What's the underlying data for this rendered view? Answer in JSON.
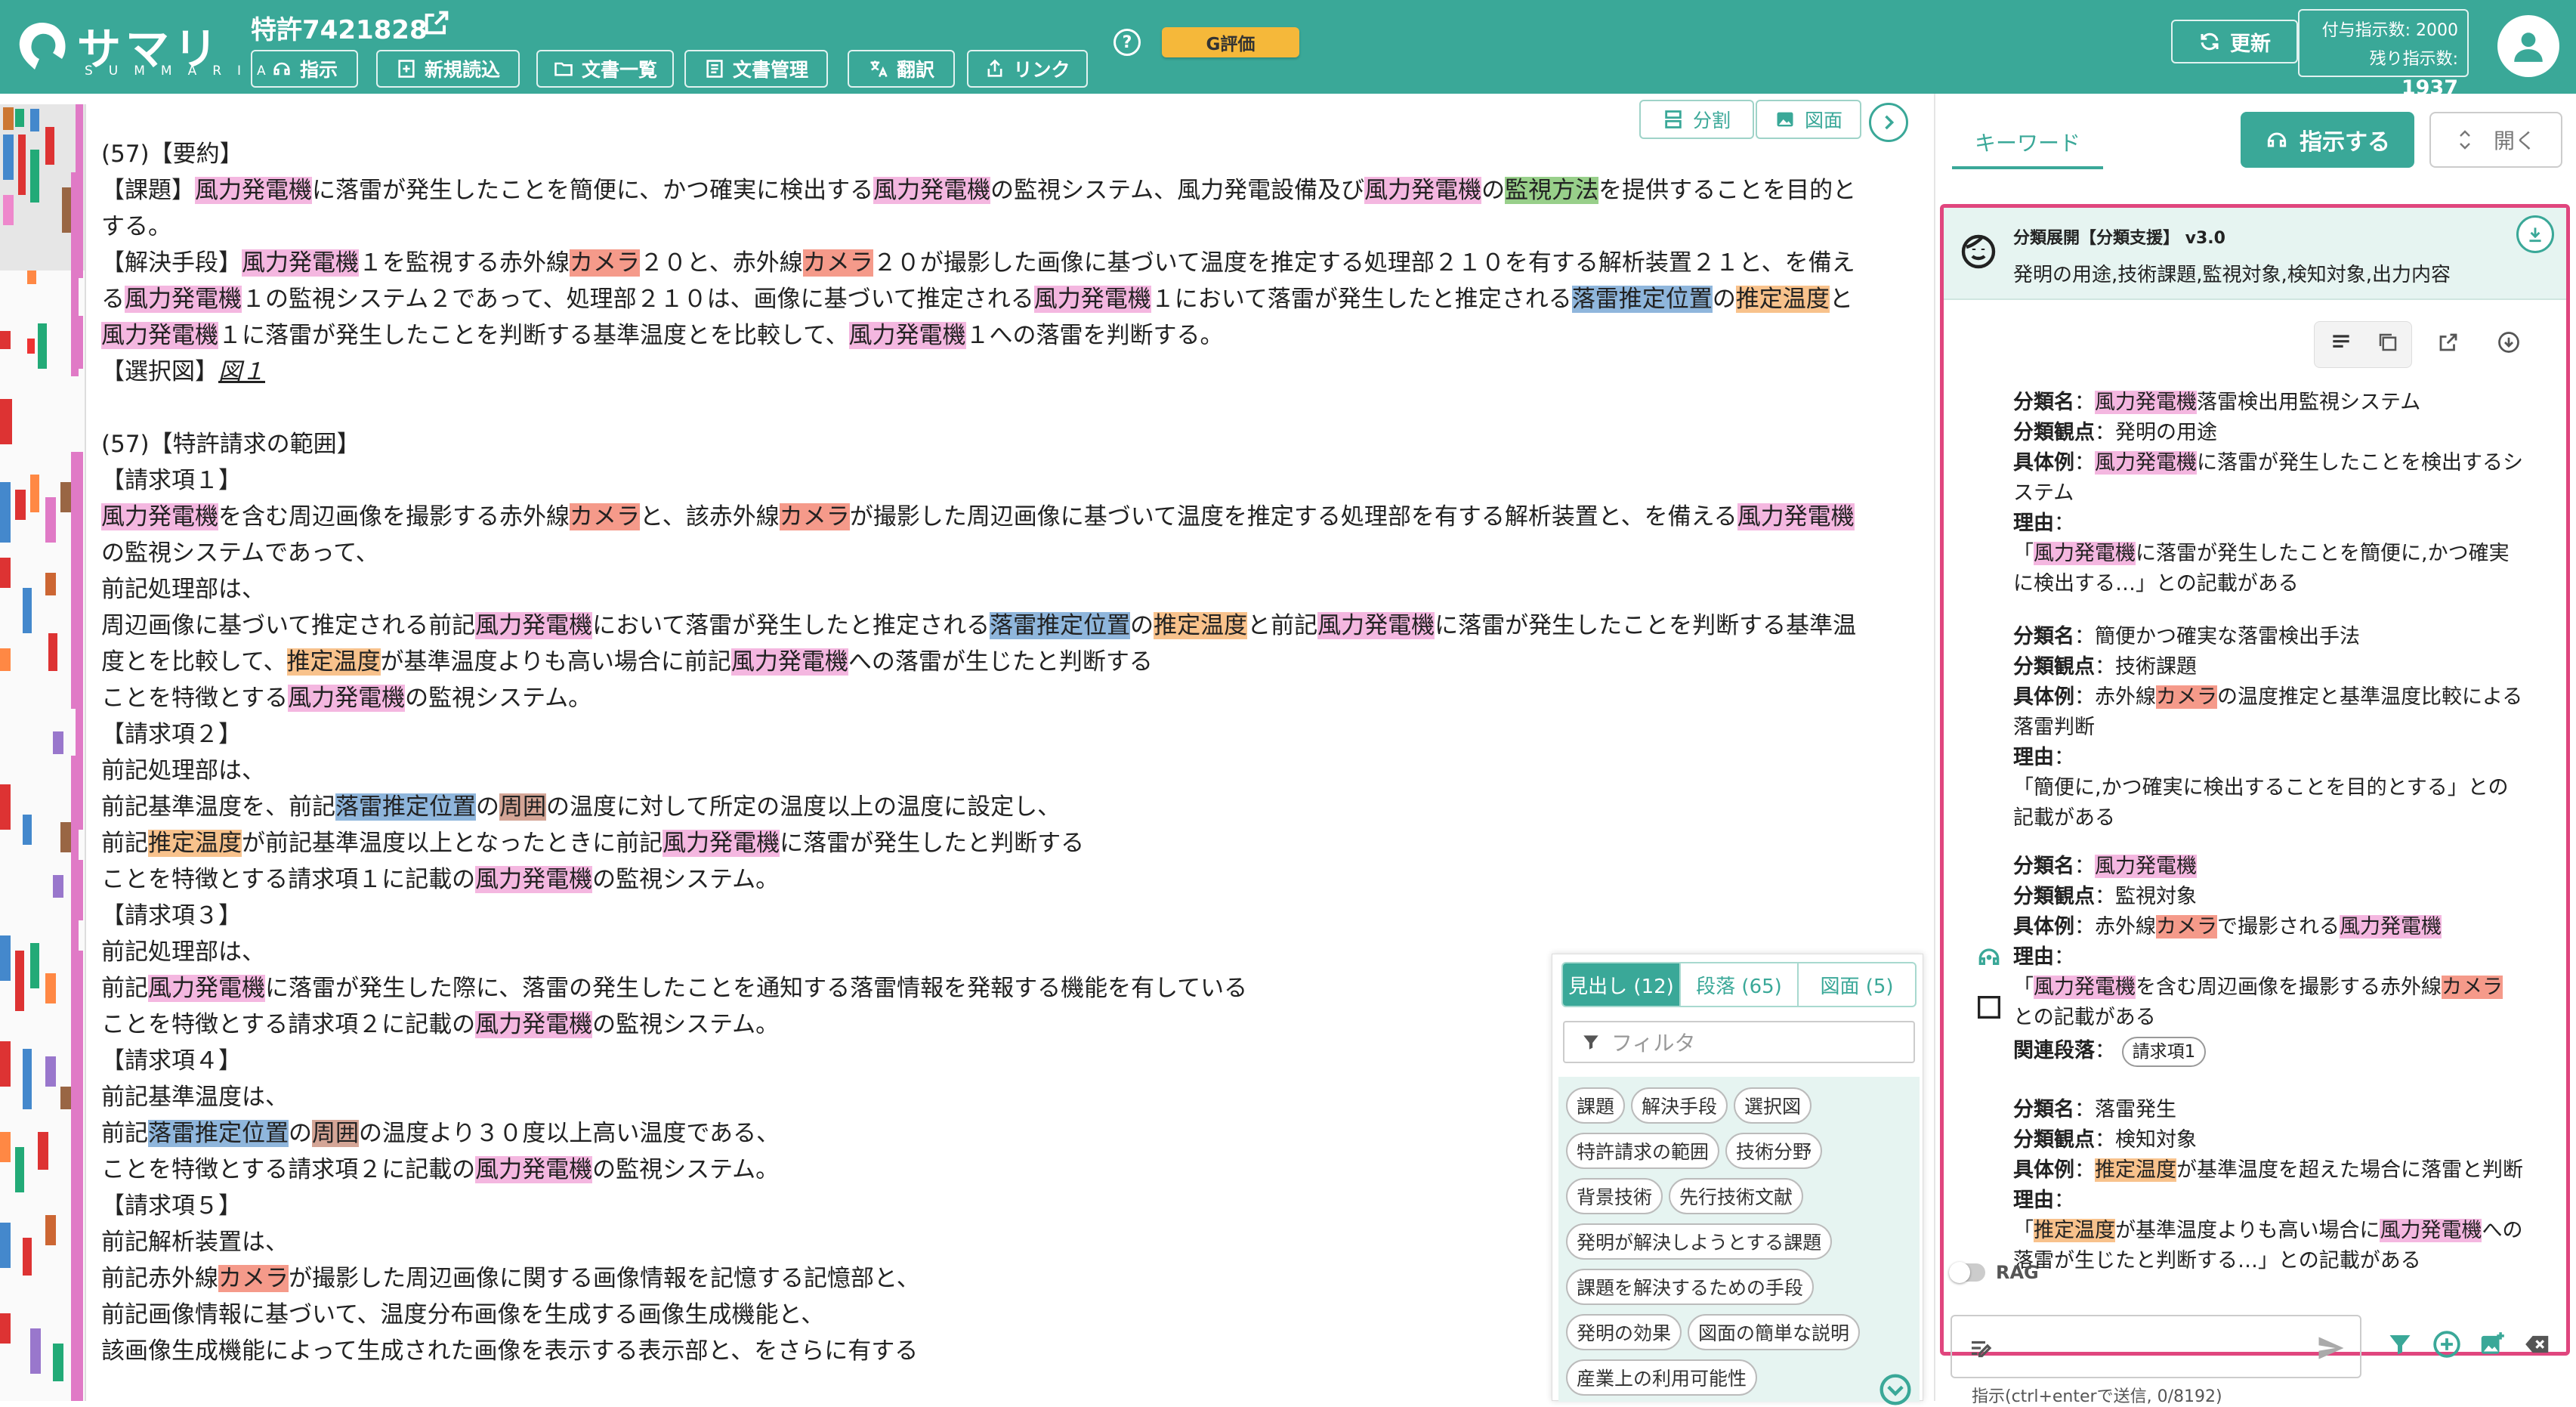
{
  "header": {
    "logo_text": "サマリア",
    "logo_sub": "SUMMARIA",
    "patent_title": "特許7421828",
    "nav": [
      "指示",
      "新規読込",
      "文書一覧",
      "文書管理",
      "翻訳",
      "リンク"
    ],
    "help": "?",
    "g_eval": "G評価",
    "update": "更新",
    "quota_label1": "付与指示数: 2000",
    "quota_label2": "残り指示数: ",
    "quota_value2": "1937"
  },
  "doc_toolbar": {
    "split": "分割",
    "figure": "図面"
  },
  "document": {
    "abstract_heading": "(57)【要約】",
    "claims_heading": "(57)【特許請求の範囲】",
    "selected_figure_label": "【選択図】",
    "selected_figure": "図１"
  },
  "outline": {
    "tabs": [
      "見出し (12)",
      "段落 (65)",
      "図面 (5)"
    ],
    "filter_placeholder": "フィルタ",
    "chips": [
      "課題",
      "解決手段",
      "選択図",
      "特許請求の範囲",
      "技術分野",
      "背景技術",
      "先行技術文献",
      "発明が解決しようとする課題",
      "課題を解決するための手段",
      "発明の効果",
      "図面の簡単な説明",
      "産業上の利用可能性"
    ]
  },
  "right_panel": {
    "keyword_tab": "キーワード",
    "instruct_btn": "指示する",
    "open_btn": "開く",
    "result_title": "分類展開【分類支援】 v3.0",
    "result_sub": "発明の用途,技術課題,監視対象,検知対象,出力内容",
    "labels": {
      "name": "分類名",
      "view": "分類観点",
      "example": "具体例",
      "reason": "理由",
      "related": "関連段落"
    },
    "related_chip": "請求項1",
    "rag": "RAG",
    "input_hint": "指示(ctrl+enterで送信, 0/8192)"
  },
  "colors": {
    "accent": "#3aa898",
    "highlight_pink": "#f4b7e0",
    "highlight_red": "#f59a8a",
    "highlight_blue": "#8fb6dc",
    "highlight_orange": "#f8c28c",
    "border_red": "#e0467e"
  }
}
